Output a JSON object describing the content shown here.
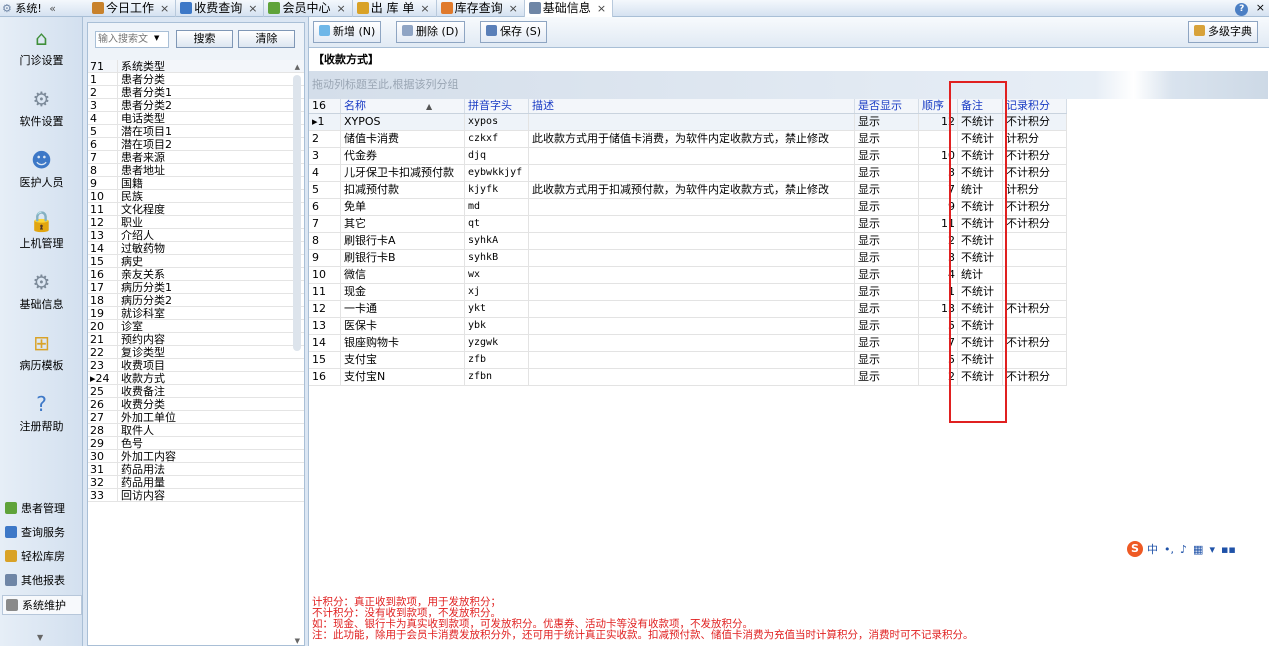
{
  "system_menu": {
    "label": "系统!",
    "collapse": "«"
  },
  "tabs": [
    {
      "label": "今日工作",
      "color": "#c8822c"
    },
    {
      "label": "收费查询",
      "color": "#3d78c7"
    },
    {
      "label": "会员中心",
      "color": "#5fa33a"
    },
    {
      "label": "出 库 单",
      "color": "#d9a227"
    },
    {
      "label": "库存查询",
      "color": "#e07a2c"
    },
    {
      "label": "基础信息",
      "color": "#6f86a6",
      "active": true
    }
  ],
  "tab_close": "×",
  "help": {
    "q": "?",
    "close": "×"
  },
  "nav_big": [
    {
      "label": "门诊设置",
      "icon": "home-icon"
    },
    {
      "label": "软件设置",
      "icon": "gears-icon"
    },
    {
      "label": "医护人员",
      "icon": "people-icon"
    },
    {
      "label": "上机管理",
      "icon": "lock-icon"
    },
    {
      "label": "基础信息",
      "icon": "gear-doc-icon"
    },
    {
      "label": "病历模板",
      "icon": "tree-icon"
    },
    {
      "label": "注册帮助",
      "icon": "help-icon"
    }
  ],
  "nav_small": [
    {
      "label": "患者管理",
      "color": "#5fa33a"
    },
    {
      "label": "查询服务",
      "color": "#3d78c7"
    },
    {
      "label": "轻松库房",
      "color": "#d9a227"
    },
    {
      "label": "其他报表",
      "color": "#6f86a6"
    },
    {
      "label": "系统维护",
      "color": "#8a8a8a",
      "selected": true
    }
  ],
  "nav_expand": "▼",
  "left_panel": {
    "search_placeholder": "输入搜索文",
    "dropdown": "▼",
    "search_btn": "搜索",
    "clear_btn": "清除",
    "header": {
      "no": "71",
      "name": "系统类型"
    },
    "items": [
      {
        "no": "1",
        "name": "患者分类"
      },
      {
        "no": "2",
        "name": "患者分类1"
      },
      {
        "no": "3",
        "name": "患者分类2"
      },
      {
        "no": "4",
        "name": "电话类型"
      },
      {
        "no": "5",
        "name": "潜在项目1"
      },
      {
        "no": "6",
        "name": "潜在项目2"
      },
      {
        "no": "7",
        "name": "患者来源"
      },
      {
        "no": "8",
        "name": "患者地址"
      },
      {
        "no": "9",
        "name": "国籍"
      },
      {
        "no": "10",
        "name": "民族"
      },
      {
        "no": "11",
        "name": "文化程度"
      },
      {
        "no": "12",
        "name": "职业"
      },
      {
        "no": "13",
        "name": "介绍人"
      },
      {
        "no": "14",
        "name": "过敏药物"
      },
      {
        "no": "15",
        "name": "病史"
      },
      {
        "no": "16",
        "name": "亲友关系"
      },
      {
        "no": "17",
        "name": "病历分类1"
      },
      {
        "no": "18",
        "name": "病历分类2"
      },
      {
        "no": "19",
        "name": "就诊科室"
      },
      {
        "no": "20",
        "name": "诊室"
      },
      {
        "no": "21",
        "name": "预约内容"
      },
      {
        "no": "22",
        "name": "复诊类型"
      },
      {
        "no": "23",
        "name": "收费项目"
      },
      {
        "no": "▸24",
        "name": "收款方式"
      },
      {
        "no": "25",
        "name": "收费备注"
      },
      {
        "no": "26",
        "name": "收费分类"
      },
      {
        "no": "27",
        "name": "外加工单位"
      },
      {
        "no": "28",
        "name": "取件人"
      },
      {
        "no": "29",
        "name": "色号"
      },
      {
        "no": "30",
        "name": "外加工内容"
      },
      {
        "no": "31",
        "name": "药品用法"
      },
      {
        "no": "32",
        "name": "药品用量"
      },
      {
        "no": "33",
        "name": "回访内容"
      }
    ],
    "scroll_up": "▲",
    "scroll_down": "▼"
  },
  "toolbar": {
    "add": "新增 (N)",
    "delete": "删除 (D)",
    "save": "保存 (S)",
    "multilevel": "多级字典"
  },
  "section_title": "【收款方式】",
  "group_hint": "拖动列标题至此,根据该列分组",
  "grid": {
    "columns": {
      "no": "16",
      "name": "名称",
      "sort_arrow": "▲",
      "pinyin": "拼音字头",
      "desc": "描述",
      "show": "是否显示",
      "order": "顺序",
      "remark": "备注",
      "points": "记录积分"
    },
    "rows": [
      {
        "no": "▸1",
        "name": "XYPOS",
        "pinyin": "xypos",
        "desc": "",
        "show": "显示",
        "order": "12",
        "remark": "不统计",
        "points": "不计积分"
      },
      {
        "no": "2",
        "name": "储值卡消费",
        "pinyin": "czkxf",
        "desc": "此收款方式用于储值卡消费，为软件内定收款方式，禁止修改",
        "show": "显示",
        "order": "",
        "remark": "不统计",
        "points": "计积分"
      },
      {
        "no": "3",
        "name": "代金券",
        "pinyin": "djq",
        "desc": "",
        "show": "显示",
        "order": "10",
        "remark": "不统计",
        "points": "不计积分"
      },
      {
        "no": "4",
        "name": "儿牙保卫卡扣减预付款",
        "pinyin": "eybwkkjyf",
        "desc": "",
        "show": "显示",
        "order": "3",
        "remark": "不统计",
        "points": "不计积分"
      },
      {
        "no": "5",
        "name": "扣减预付款",
        "pinyin": "kjyfk",
        "desc": "此收款方式用于扣减预付款，为软件内定收款方式，禁止修改",
        "show": "显示",
        "order": "7",
        "remark": "统计",
        "points": "计积分"
      },
      {
        "no": "6",
        "name": "免单",
        "pinyin": "md",
        "desc": "",
        "show": "显示",
        "order": "9",
        "remark": "不统计",
        "points": "不计积分"
      },
      {
        "no": "7",
        "name": "其它",
        "pinyin": "qt",
        "desc": "",
        "show": "显示",
        "order": "11",
        "remark": "不统计",
        "points": "不计积分"
      },
      {
        "no": "8",
        "name": "刷银行卡A",
        "pinyin": "syhkA",
        "desc": "",
        "show": "显示",
        "order": "2",
        "remark": "不统计",
        "points": ""
      },
      {
        "no": "9",
        "name": "刷银行卡B",
        "pinyin": "syhkB",
        "desc": "",
        "show": "显示",
        "order": "3",
        "remark": "不统计",
        "points": ""
      },
      {
        "no": "10",
        "name": "微信",
        "pinyin": "wx",
        "desc": "",
        "show": "显示",
        "order": "4",
        "remark": "统计",
        "points": ""
      },
      {
        "no": "11",
        "name": "现金",
        "pinyin": "xj",
        "desc": "",
        "show": "显示",
        "order": "1",
        "remark": "不统计",
        "points": ""
      },
      {
        "no": "12",
        "name": "一卡通",
        "pinyin": "ykt",
        "desc": "",
        "show": "显示",
        "order": "13",
        "remark": "不统计",
        "points": "不计积分"
      },
      {
        "no": "13",
        "name": "医保卡",
        "pinyin": "ybk",
        "desc": "",
        "show": "显示",
        "order": "5",
        "remark": "不统计",
        "points": ""
      },
      {
        "no": "14",
        "name": "银座购物卡",
        "pinyin": "yzgwk",
        "desc": "",
        "show": "显示",
        "order": "7",
        "remark": "不统计",
        "points": "不计积分"
      },
      {
        "no": "15",
        "name": "支付宝",
        "pinyin": "zfb",
        "desc": "",
        "show": "显示",
        "order": "5",
        "remark": "不统计",
        "points": ""
      },
      {
        "no": "16",
        "name": "支付宝N",
        "pinyin": "zfbn",
        "desc": "",
        "show": "显示",
        "order": "2",
        "remark": "不统计",
        "points": "不计积分"
      }
    ]
  },
  "notes": [
    "计积分：真正收到款项，用于发放积分；",
    "不计积分：没有收到款项，不发放积分。",
    "如：现金、银行卡为真实收到款项，可发放积分。优惠券、活动卡等没有收款项，不发放积分。",
    "注：此功能，除用于会员卡消费发放积分外，还可用于统计真正实收款。扣减预付款、储值卡消费为充值当时计算积分，消费时可不记录积分。"
  ],
  "ime": {
    "logo": "S",
    "items": [
      "中",
      "•,",
      "♪",
      "▦",
      "▾",
      "▪▪"
    ]
  },
  "colors": {
    "accent_blue": "#1a3cc4",
    "highlight_red": "#e02020",
    "panel_bg": "#dbe6f3"
  }
}
